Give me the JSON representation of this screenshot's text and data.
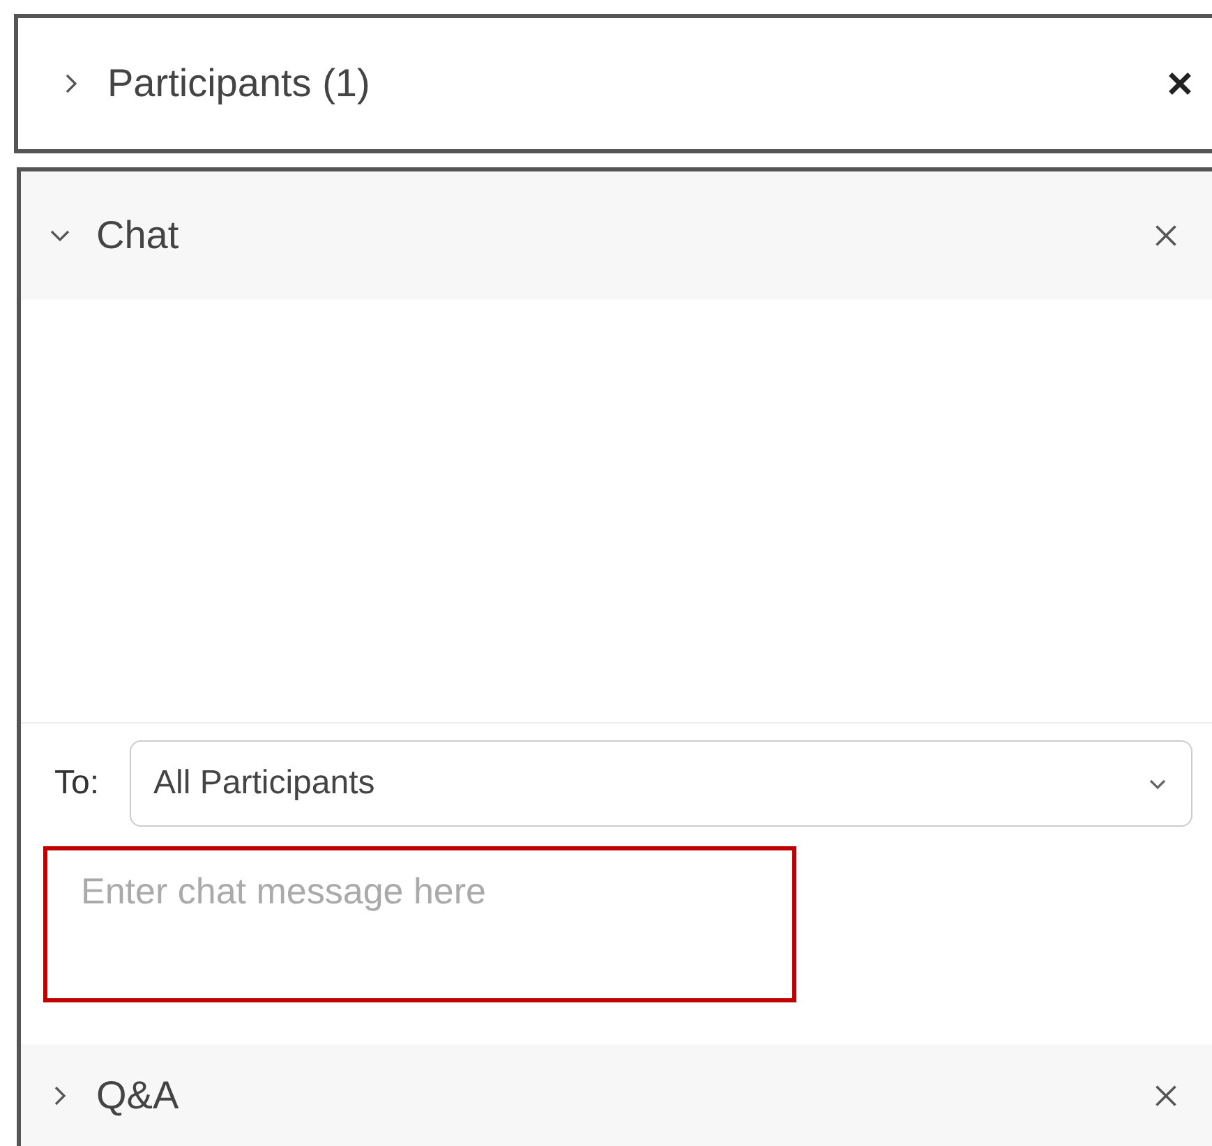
{
  "panels": [
    {
      "kind": "collapsed-box",
      "title": "Participants (1)",
      "expanded": false
    },
    {
      "kind": "chat",
      "title": "Chat",
      "expanded": true,
      "to_label": "To:",
      "recipient": "All Participants",
      "message": {
        "placeholder": "Enter chat message here",
        "highlighted": true
      }
    },
    {
      "kind": "section",
      "title": "Q&A",
      "expanded": false
    }
  ]
}
